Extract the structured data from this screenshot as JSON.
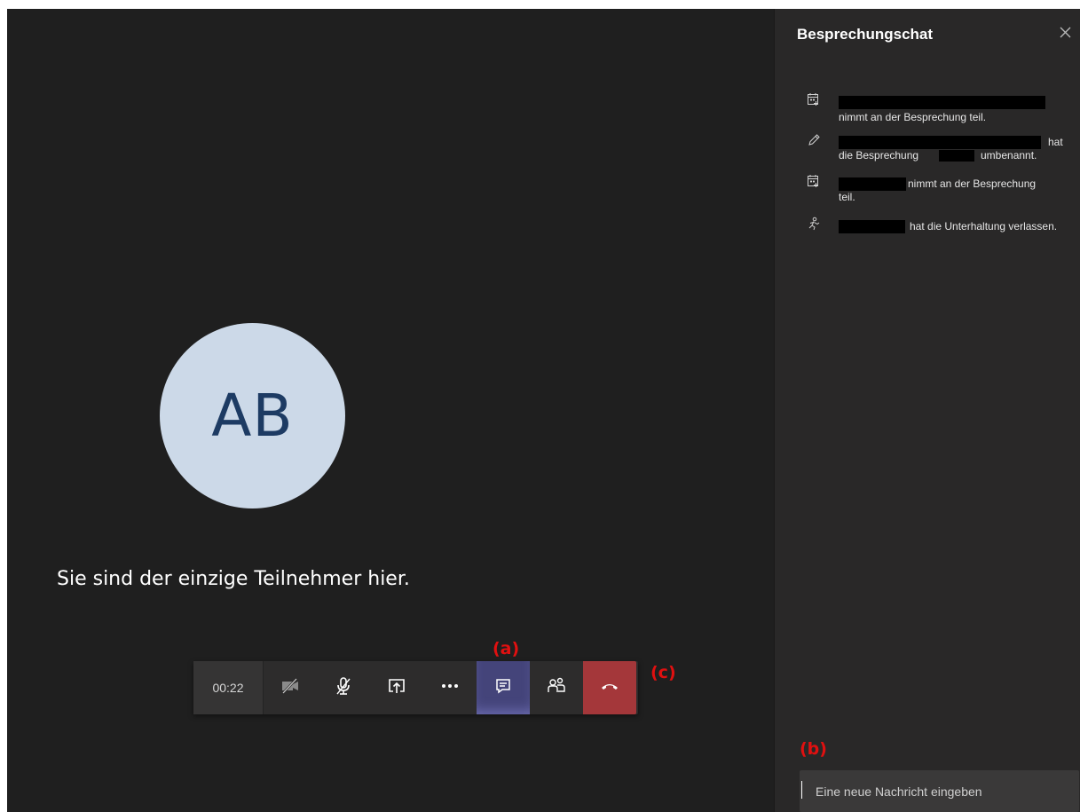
{
  "call": {
    "avatar_initials": "AB",
    "alone_message": "Sie sind der einzige Teilnehmer hier."
  },
  "toolbar": {
    "timer": "00:22",
    "buttons": [
      {
        "name": "camera-toggle",
        "icon": "video-off-icon"
      },
      {
        "name": "mic-toggle",
        "icon": "mic-off-icon"
      },
      {
        "name": "share-screen",
        "icon": "share-screen-icon"
      },
      {
        "name": "more-actions",
        "icon": "more-icon"
      },
      {
        "name": "show-chat",
        "icon": "chat-icon",
        "active": true
      },
      {
        "name": "show-participants",
        "icon": "participants-icon"
      },
      {
        "name": "hang-up",
        "icon": "hangup-icon"
      }
    ],
    "colors": {
      "active": "#44447a",
      "hangup": "#a4373a"
    }
  },
  "annotations": {
    "a": "(a)",
    "b": "(b)",
    "c": "(c)"
  },
  "chat": {
    "title": "Besprechungschat",
    "events": [
      {
        "icon": "calendar-add-icon",
        "line1": "",
        "line2": "nimmt an der Besprechung teil."
      },
      {
        "icon": "pencil-icon",
        "line1": "hat",
        "line2a": "die Besprechung",
        "line2b": "umbenannt."
      },
      {
        "icon": "calendar-add-icon",
        "line1": "nimmt an der Besprechung",
        "line2": "teil."
      },
      {
        "icon": "person-leave-icon",
        "line1": "hat die Unterhaltung verlassen."
      }
    ],
    "input_placeholder": "Eine neue Nachricht eingeben"
  }
}
